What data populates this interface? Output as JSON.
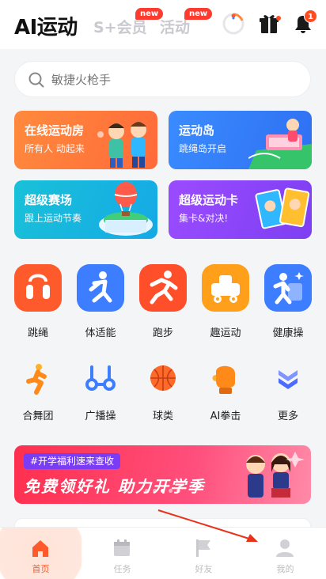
{
  "header": {
    "tabs": [
      {
        "label": "AI运动"
      },
      {
        "label": "S+会员",
        "badge": "new"
      },
      {
        "label": "活动",
        "badge": "new"
      }
    ],
    "notification_count": "1"
  },
  "search": {
    "placeholder": "敏捷火枪手"
  },
  "cards": [
    {
      "title": "在线运动房",
      "subtitle": "所有人 动起来",
      "color": "#ff7a3a"
    },
    {
      "title": "运动岛",
      "subtitle": "跳绳岛开启",
      "color": "#3a86ff"
    },
    {
      "title": "超级赛场",
      "subtitle": "跟上运动节奏",
      "color": "#1ab8dd"
    },
    {
      "title": "超级运动卡",
      "subtitle": "集卡&对决!",
      "color": "#8c45f8"
    }
  ],
  "grid_row1": [
    {
      "label": "跳绳",
      "icon": "jump-rope-icon"
    },
    {
      "label": "体适能",
      "icon": "fitness-icon"
    },
    {
      "label": "跑步",
      "icon": "running-icon"
    },
    {
      "label": "趣运动",
      "icon": "fun-sport-icon"
    },
    {
      "label": "健康操",
      "icon": "aerobics-icon"
    }
  ],
  "grid_row2": [
    {
      "label": "合舞团",
      "icon": "dance-icon"
    },
    {
      "label": "广播操",
      "icon": "dumbbell-icon"
    },
    {
      "label": "球类",
      "icon": "basketball-icon"
    },
    {
      "label": "AI拳击",
      "icon": "boxing-glove-icon"
    },
    {
      "label": "更多",
      "icon": "more-chevron-icon"
    }
  ],
  "banner": {
    "tag": "#开学福利速来查收",
    "title": "免费领好礼 助力开学季"
  },
  "bottom_nav": [
    {
      "label": "首页",
      "icon": "home-icon",
      "active": true
    },
    {
      "label": "任务",
      "icon": "calendar-icon"
    },
    {
      "label": "好友",
      "icon": "flag-icon"
    },
    {
      "label": "我的",
      "icon": "profile-icon"
    }
  ],
  "colors": {
    "accent": "#ff5a2c",
    "annotation_arrow": "#e8321c"
  }
}
